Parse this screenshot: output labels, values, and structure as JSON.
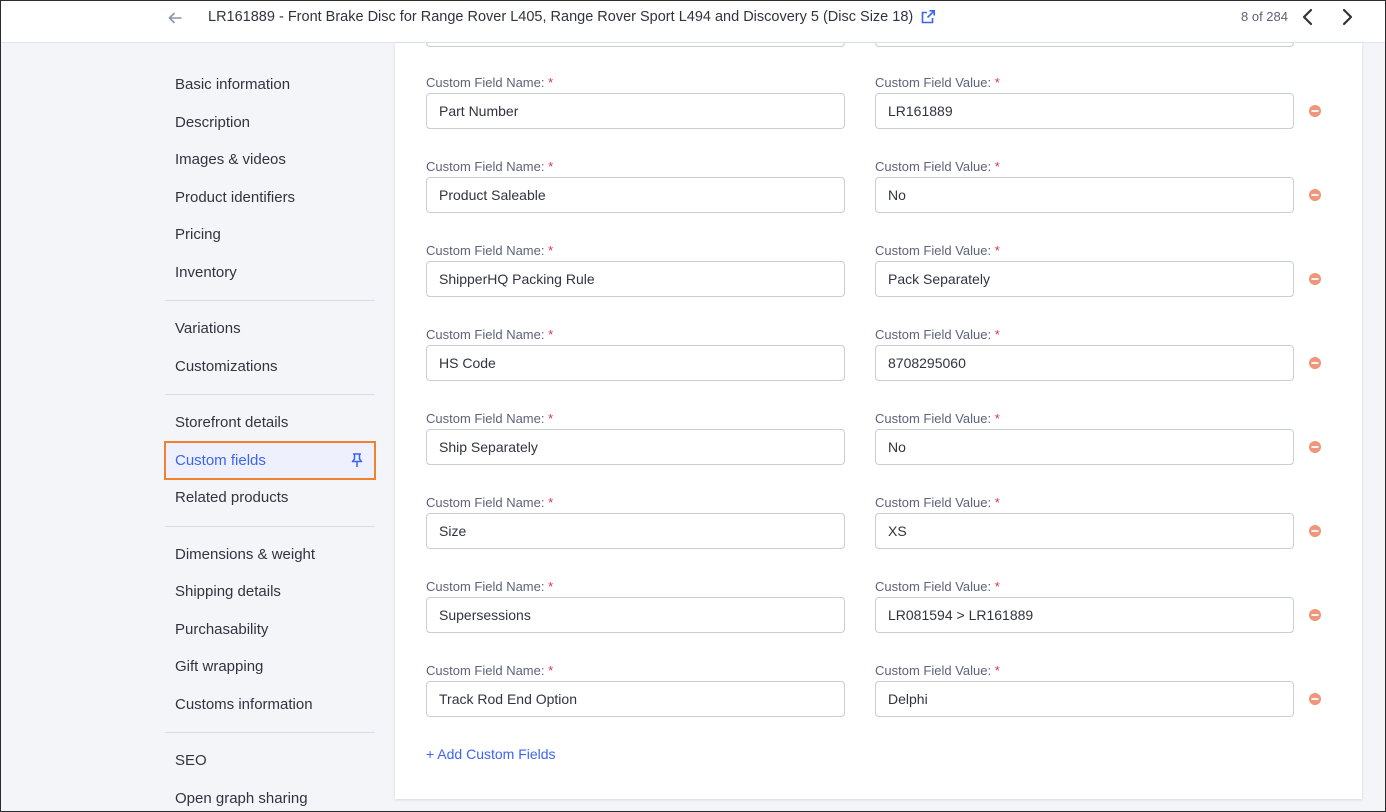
{
  "header": {
    "sku": "LR161889",
    "title": "Front Brake Disc for Range Rover L405, Range Rover Sport L494 and Discovery 5 (Disc Size 18)",
    "pager": "8 of 284",
    "icons": {
      "back": "arrow-left-icon",
      "external": "external-link-icon",
      "prev": "chevron-left-icon",
      "next": "chevron-right-icon"
    }
  },
  "sidebar": {
    "groups": [
      {
        "items": [
          {
            "label": "Basic information"
          },
          {
            "label": "Description"
          },
          {
            "label": "Images & videos"
          },
          {
            "label": "Product identifiers"
          },
          {
            "label": "Pricing"
          },
          {
            "label": "Inventory"
          }
        ]
      },
      {
        "items": [
          {
            "label": "Variations"
          },
          {
            "label": "Customizations"
          }
        ]
      },
      {
        "items": [
          {
            "label": "Storefront details"
          },
          {
            "label": "Custom fields",
            "active": true
          },
          {
            "label": "Related products"
          }
        ]
      },
      {
        "items": [
          {
            "label": "Dimensions & weight"
          },
          {
            "label": "Shipping details"
          },
          {
            "label": "Purchasability"
          },
          {
            "label": "Gift wrapping"
          },
          {
            "label": "Customs information"
          }
        ]
      },
      {
        "items": [
          {
            "label": "SEO"
          },
          {
            "label": "Open graph sharing"
          }
        ]
      }
    ]
  },
  "custom_fields": {
    "name_label": "Custom Field Name:",
    "value_label": "Custom Field Value:",
    "required_mark": "*",
    "rows": [
      {
        "name": "Part Number",
        "value": "LR161889"
      },
      {
        "name": "Product Saleable",
        "value": "No"
      },
      {
        "name": "ShipperHQ Packing Rule",
        "value": "Pack Separately"
      },
      {
        "name": "HS Code",
        "value": "8708295060"
      },
      {
        "name": "Ship Separately",
        "value": "No"
      },
      {
        "name": "Size",
        "value": "XS"
      },
      {
        "name": "Supersessions",
        "value": "LR081594 > LR161889"
      },
      {
        "name": "Track Rod End Option",
        "value": "Delphi"
      }
    ],
    "add_label": "+ Add Custom Fields"
  },
  "colors": {
    "accent": "#3c64f4",
    "required": "#db3643",
    "remove": "#f0967a",
    "highlight_outline": "#f0822e"
  }
}
